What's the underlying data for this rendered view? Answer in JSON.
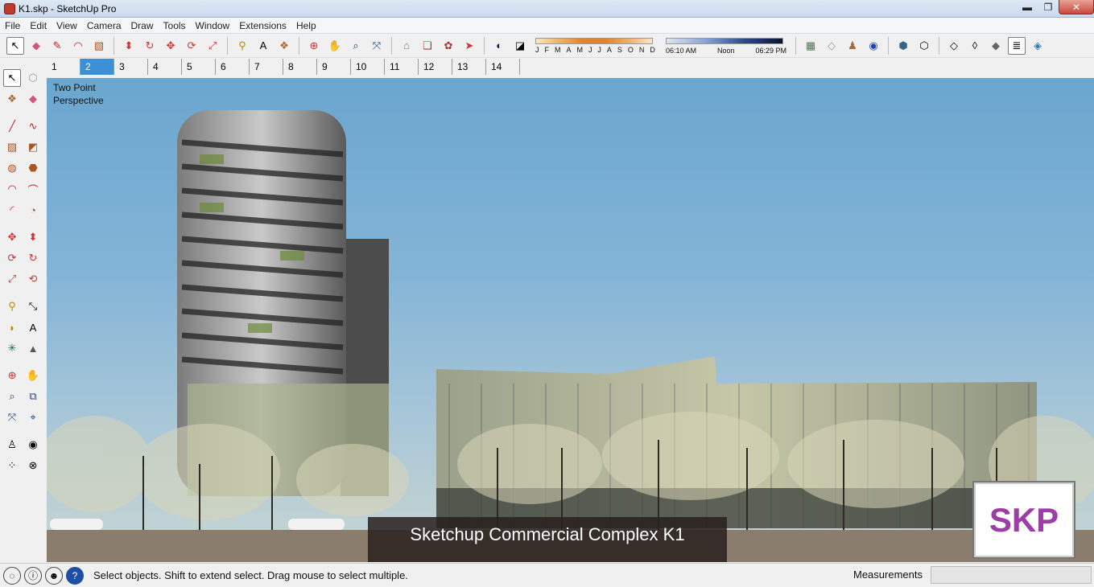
{
  "window": {
    "title": "K1.skp - SketchUp Pro"
  },
  "window_controls": {
    "minimize": "▬",
    "restore": "❐",
    "close": "✕"
  },
  "menu": [
    "File",
    "Edit",
    "View",
    "Camera",
    "Draw",
    "Tools",
    "Window",
    "Extensions",
    "Help"
  ],
  "toolbar": {
    "icons": [
      "select-icon",
      "eraser-icon",
      "pencil-icon",
      "arc-icon",
      "rectangle-icon",
      "push-pull-icon",
      "follow-me-icon",
      "move-icon",
      "rotate-icon",
      "scale-icon",
      "tape-measure-icon",
      "text-icon",
      "paint-bucket-icon",
      "orbit-icon",
      "pan-icon",
      "zoom-icon",
      "zoom-extents-icon",
      "warehouse-icon",
      "components-icon",
      "extension-icon",
      "send-to-layout-icon",
      "shadows-icon",
      "fog-icon"
    ],
    "months": [
      "J",
      "F",
      "M",
      "A",
      "M",
      "J",
      "J",
      "A",
      "S",
      "O",
      "N",
      "D"
    ],
    "time": {
      "start": "06:10 AM",
      "mid": "Noon",
      "end": "06:29 PM"
    },
    "right_icons": [
      "geo-location-icon",
      "toggle-terrain-icon",
      "photo-textures-icon",
      "add-location-icon",
      "xray-icon",
      "back-edges-icon",
      "wireframe-icon",
      "hidden-line-icon",
      "shaded-icon",
      "shaded-textures-icon",
      "monochrome-icon"
    ]
  },
  "scene_tabs": [
    "1",
    "2",
    "3",
    "4",
    "5",
    "6",
    "7",
    "8",
    "9",
    "10",
    "11",
    "12",
    "13",
    "14"
  ],
  "active_tab": "2",
  "viewport": {
    "perspective_label": "Two Point\nPerspective",
    "caption": "Sketchup Commercial Complex K1",
    "logo": "SKP"
  },
  "status": {
    "message": "Select objects. Shift to extend select. Drag mouse to select multiple.",
    "measurements_label": "Measurements",
    "measurements_value": ""
  }
}
